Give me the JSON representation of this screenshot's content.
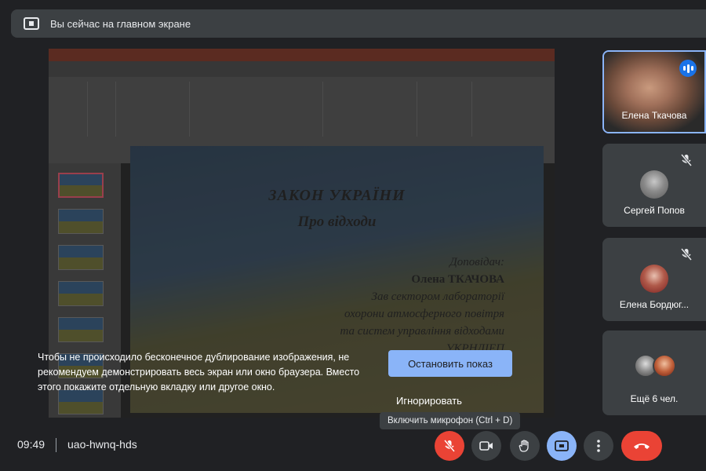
{
  "banner": {
    "text": "Вы сейчас на главном экране"
  },
  "slide": {
    "title": "ЗАКОН УКРАЇНИ",
    "subtitle": "Про відходи",
    "lines": [
      "Доповідач:",
      "Олена ТКАЧОВА",
      "Зав сектором лабораторії",
      "охорони атмосферного повітря",
      "та систем управління відходами",
      "УКРНДІЕП"
    ]
  },
  "warning": {
    "text": "Чтобы не происходило бесконечное дублирование изображения, не рекомендуем демонстрировать весь экран или окно браузера. Вместо этого покажите отдельную вкладку или другое окно.",
    "stop_label": "Остановить показ",
    "ignore_label": "Игнорировать"
  },
  "tooltip": {
    "text": "Включить микрофон (Ctrl + D)"
  },
  "participants": [
    {
      "name": "Елена Ткачова"
    },
    {
      "name": "Сергей Попов"
    },
    {
      "name": "Елена Бордюг..."
    },
    {
      "name": "Ещё 6 чел."
    }
  ],
  "meeting": {
    "time": "09:49",
    "code": "uao-hwnq-hds"
  },
  "colors": {
    "accent": "#8ab4f8",
    "danger": "#ea4335",
    "background": "#202124",
    "tile": "#3c4043"
  },
  "icons": {
    "banner": "present-screen-icon",
    "mic": "mic-off-icon",
    "camera": "camera-icon",
    "hand": "raise-hand-icon",
    "present": "present-icon",
    "more": "more-vert-icon",
    "leave": "call-end-icon"
  }
}
